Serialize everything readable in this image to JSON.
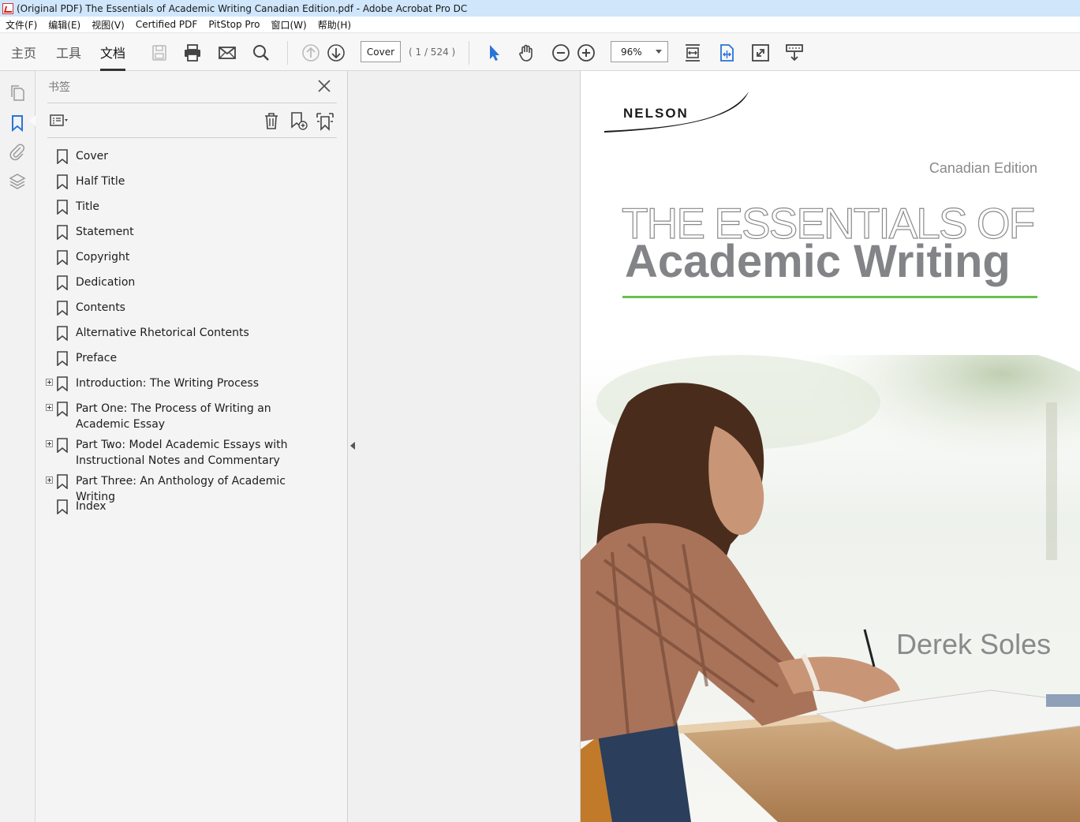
{
  "window": {
    "title": "(Original PDF) The Essentials of Academic Writing Canadian Edition.pdf - Adobe Acrobat Pro DC"
  },
  "menu": [
    "文件(F)",
    "编辑(E)",
    "视图(V)",
    "Certified PDF",
    "PitStop Pro",
    "窗口(W)",
    "帮助(H)"
  ],
  "toolbar": {
    "tabs": [
      "主页",
      "工具",
      "文档"
    ],
    "active_tab": "文档",
    "page_field_value": "Cover",
    "page_count": "( 1 / 524 )",
    "zoom_value": "96%",
    "icons": [
      "save-icon",
      "print-icon",
      "email-icon",
      "search-icon",
      "prev-page-icon",
      "next-page-icon",
      "select-pointer-icon",
      "hand-tool-icon",
      "zoom-out-icon",
      "zoom-in-icon",
      "fit-page-icon",
      "fit-width-icon",
      "full-screen-icon",
      "read-mode-icon"
    ]
  },
  "left_rail": {
    "icons": [
      "pages-icon",
      "bookmark-icon",
      "attachment-icon",
      "layers-icon"
    ],
    "active": "bookmark-icon"
  },
  "bookmarks": {
    "header": "书签",
    "items": [
      {
        "label": "Cover",
        "expandable": false
      },
      {
        "label": "Half Title",
        "expandable": false
      },
      {
        "label": "Title",
        "expandable": false
      },
      {
        "label": "Statement",
        "expandable": false
      },
      {
        "label": "Copyright",
        "expandable": false
      },
      {
        "label": "Dedication",
        "expandable": false
      },
      {
        "label": "Contents",
        "expandable": false
      },
      {
        "label": "Alternative Rhetorical Contents",
        "expandable": false
      },
      {
        "label": "Preface",
        "expandable": false
      },
      {
        "label": "Introduction: The Writing Process",
        "expandable": true
      },
      {
        "label": "Part One: The Process of Writing an Academic Essay",
        "expandable": true
      },
      {
        "label": "Part Two: Model Academic Essays with Instructional Notes and Commentary",
        "expandable": true
      },
      {
        "label": "Part Three: An Anthology of Academic Writing",
        "expandable": true
      },
      {
        "label": "Index",
        "expandable": false
      }
    ]
  },
  "cover": {
    "publisher": "NELSON",
    "edition": "Canadian Edition",
    "title_line1": "THE ESSENTIALS OF",
    "title_line2": "Academic Writing",
    "author": "Derek Soles",
    "accent_color": "#6abf4b"
  }
}
